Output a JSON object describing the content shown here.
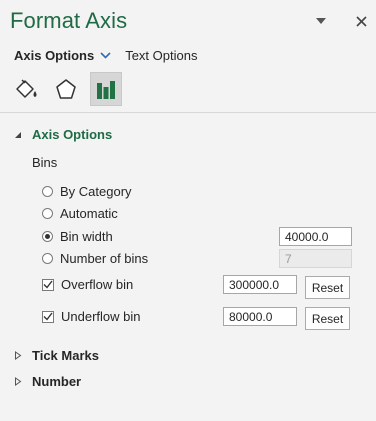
{
  "pane": {
    "title": "Format Axis"
  },
  "tabs": {
    "axis_options": "Axis Options",
    "text_options": "Text Options"
  },
  "icons": {
    "fill": "paint-bucket-icon",
    "effects": "pentagon-icon",
    "axis": "bar-chart-icon"
  },
  "sections": {
    "axis_options": "Axis Options",
    "tick_marks": "Tick Marks",
    "number": "Number"
  },
  "bins": {
    "label": "Bins",
    "by_category": "By Category",
    "automatic": "Automatic",
    "bin_width": "Bin width",
    "bin_width_value": "40000.0",
    "number_of_bins": "Number of bins",
    "number_of_bins_value": "7",
    "overflow_bin": "Overflow bin",
    "overflow_value": "300000.0",
    "underflow_bin": "Underflow bin",
    "underflow_value": "80000.0",
    "reset": "Reset"
  },
  "colors": {
    "accent": "#1f6b45",
    "background": "#f3f3f3"
  }
}
